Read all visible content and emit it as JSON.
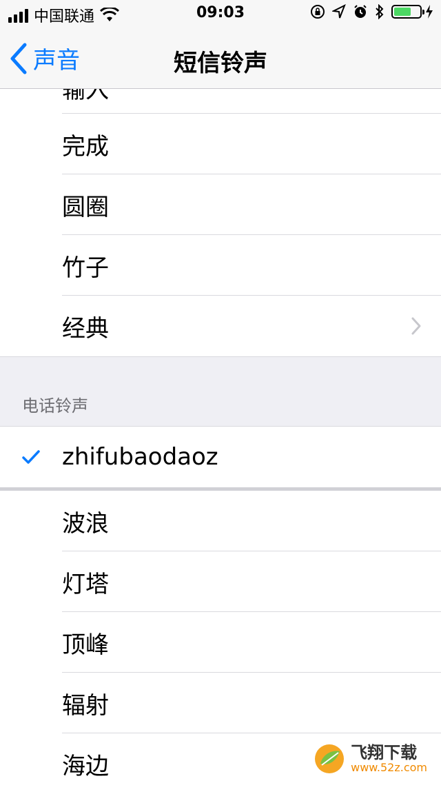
{
  "status_bar": {
    "carrier": "中国联通",
    "time": "09:03",
    "battery_level": 0.7,
    "icons": [
      "signal-icon",
      "wifi-icon",
      "rotation-lock-icon",
      "location-icon",
      "alarm-icon",
      "bluetooth-icon",
      "battery-icon",
      "charging-icon"
    ]
  },
  "nav": {
    "back_label": "声音",
    "title": "短信铃声"
  },
  "sms_tones": {
    "partial_item": "输入",
    "items": [
      {
        "label": "完成"
      },
      {
        "label": "圆圈"
      },
      {
        "label": "竹子"
      },
      {
        "label": "经典"
      }
    ]
  },
  "ringtones_section": {
    "header": "电话铃声",
    "selected": "zhifubaodaoz",
    "items": [
      {
        "label": "波浪"
      },
      {
        "label": "灯塔"
      },
      {
        "label": "顶峰"
      },
      {
        "label": "辐射"
      },
      {
        "label": "海边"
      }
    ]
  },
  "watermark": {
    "title": "飞翔下载",
    "url": "www.52z.com"
  },
  "colors": {
    "accent": "#0a7bff",
    "battery": "#4cd964",
    "group_bg": "#efeff4"
  }
}
